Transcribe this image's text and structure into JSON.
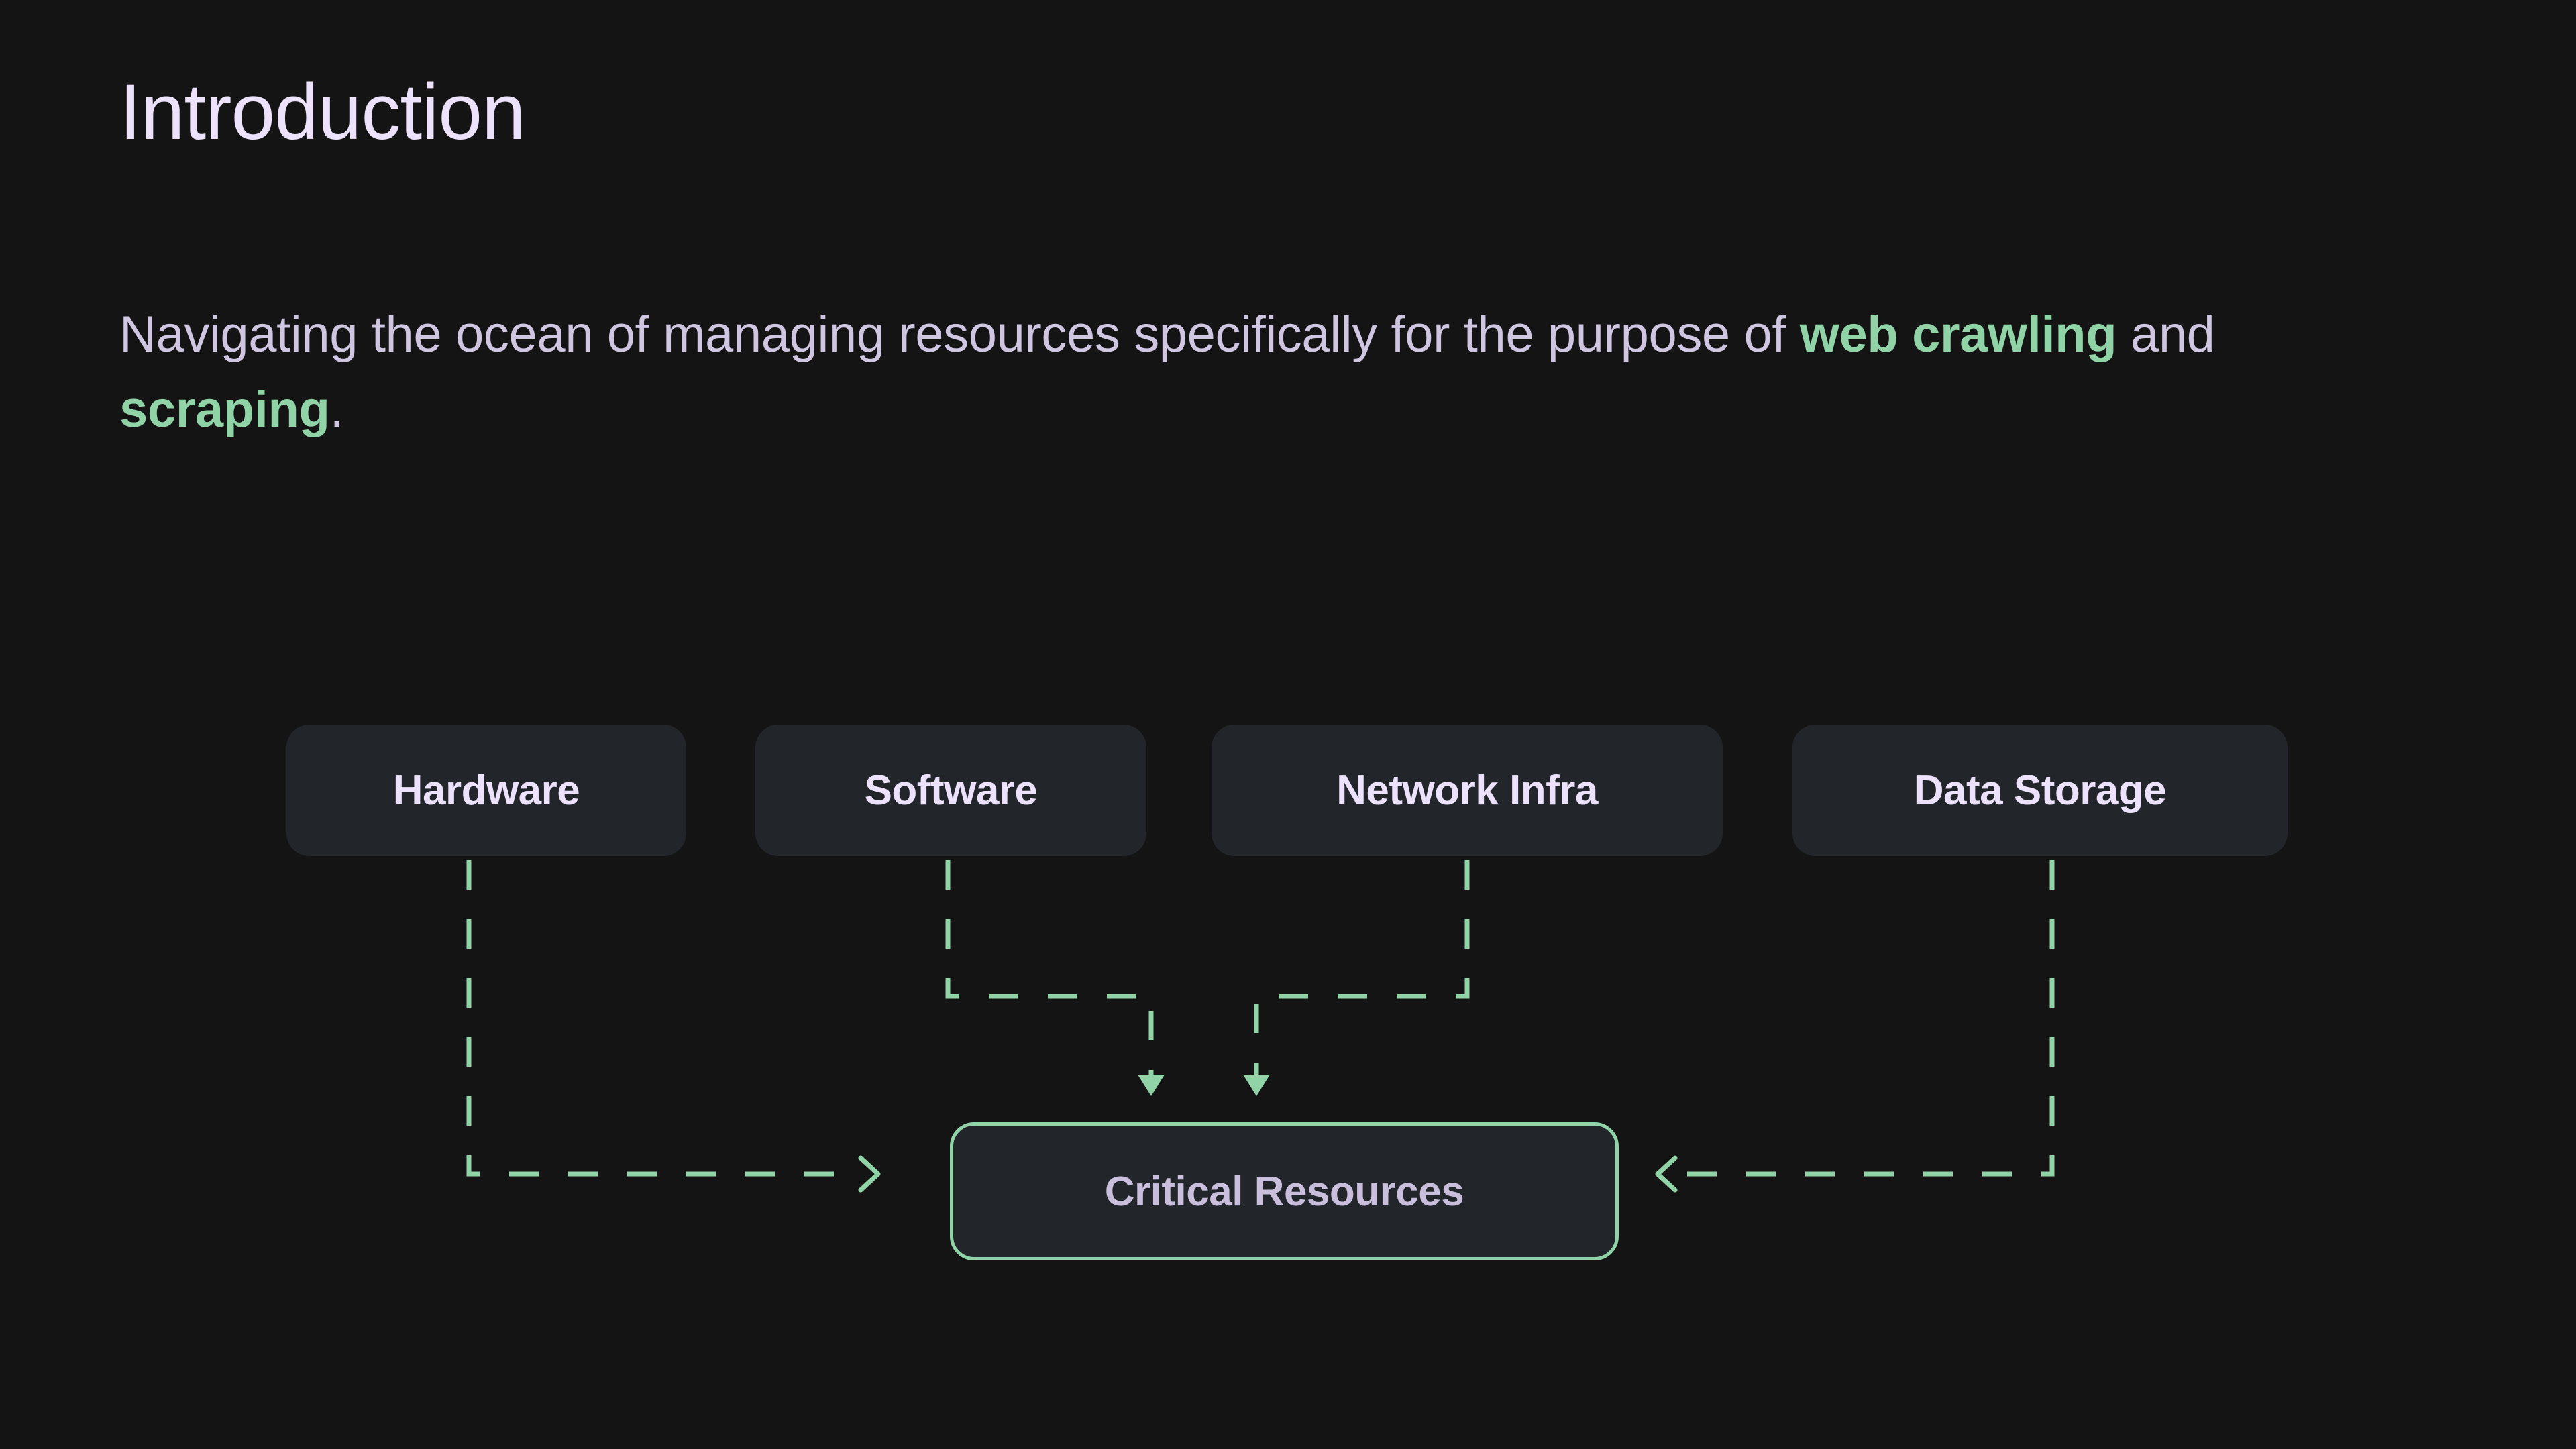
{
  "slide": {
    "background_color": "#141414",
    "title": "Introduction",
    "title_color": "#ece2fb"
  },
  "body": {
    "text_color": "#cfc6e2",
    "highlight_color": "#8fd3a6",
    "segments": {
      "lead": "Navigating the ocean of managing resources specifically for the purpose of ",
      "highlight_1": "web crawling",
      "connector": " and ",
      "highlight_2": "scraping",
      "trailing": "."
    },
    "full_text": "Navigating the ocean of managing resources specifically for the purpose of web crawling and scraping."
  },
  "diagram": {
    "type": "flow",
    "connector_color": "#8fd3a6",
    "connector_style": "dashed",
    "node_fill": "#22262b",
    "node_label_color": "#ece2fb",
    "sources": [
      {
        "id": "hardware",
        "label": "Hardware"
      },
      {
        "id": "software",
        "label": "Software"
      },
      {
        "id": "network",
        "label": "Network Infra"
      },
      {
        "id": "storage",
        "label": "Data Storage"
      }
    ],
    "target": {
      "id": "critical",
      "label": "Critical Resources",
      "border_color": "#8fd3a6",
      "label_color": "#c9bfdc"
    },
    "edges": [
      {
        "from": "hardware",
        "to": "critical",
        "arrow": "chevron-right"
      },
      {
        "from": "software",
        "to": "critical",
        "arrow": "triangle-down"
      },
      {
        "from": "network",
        "to": "critical",
        "arrow": "triangle-down"
      },
      {
        "from": "storage",
        "to": "critical",
        "arrow": "chevron-left"
      }
    ]
  }
}
